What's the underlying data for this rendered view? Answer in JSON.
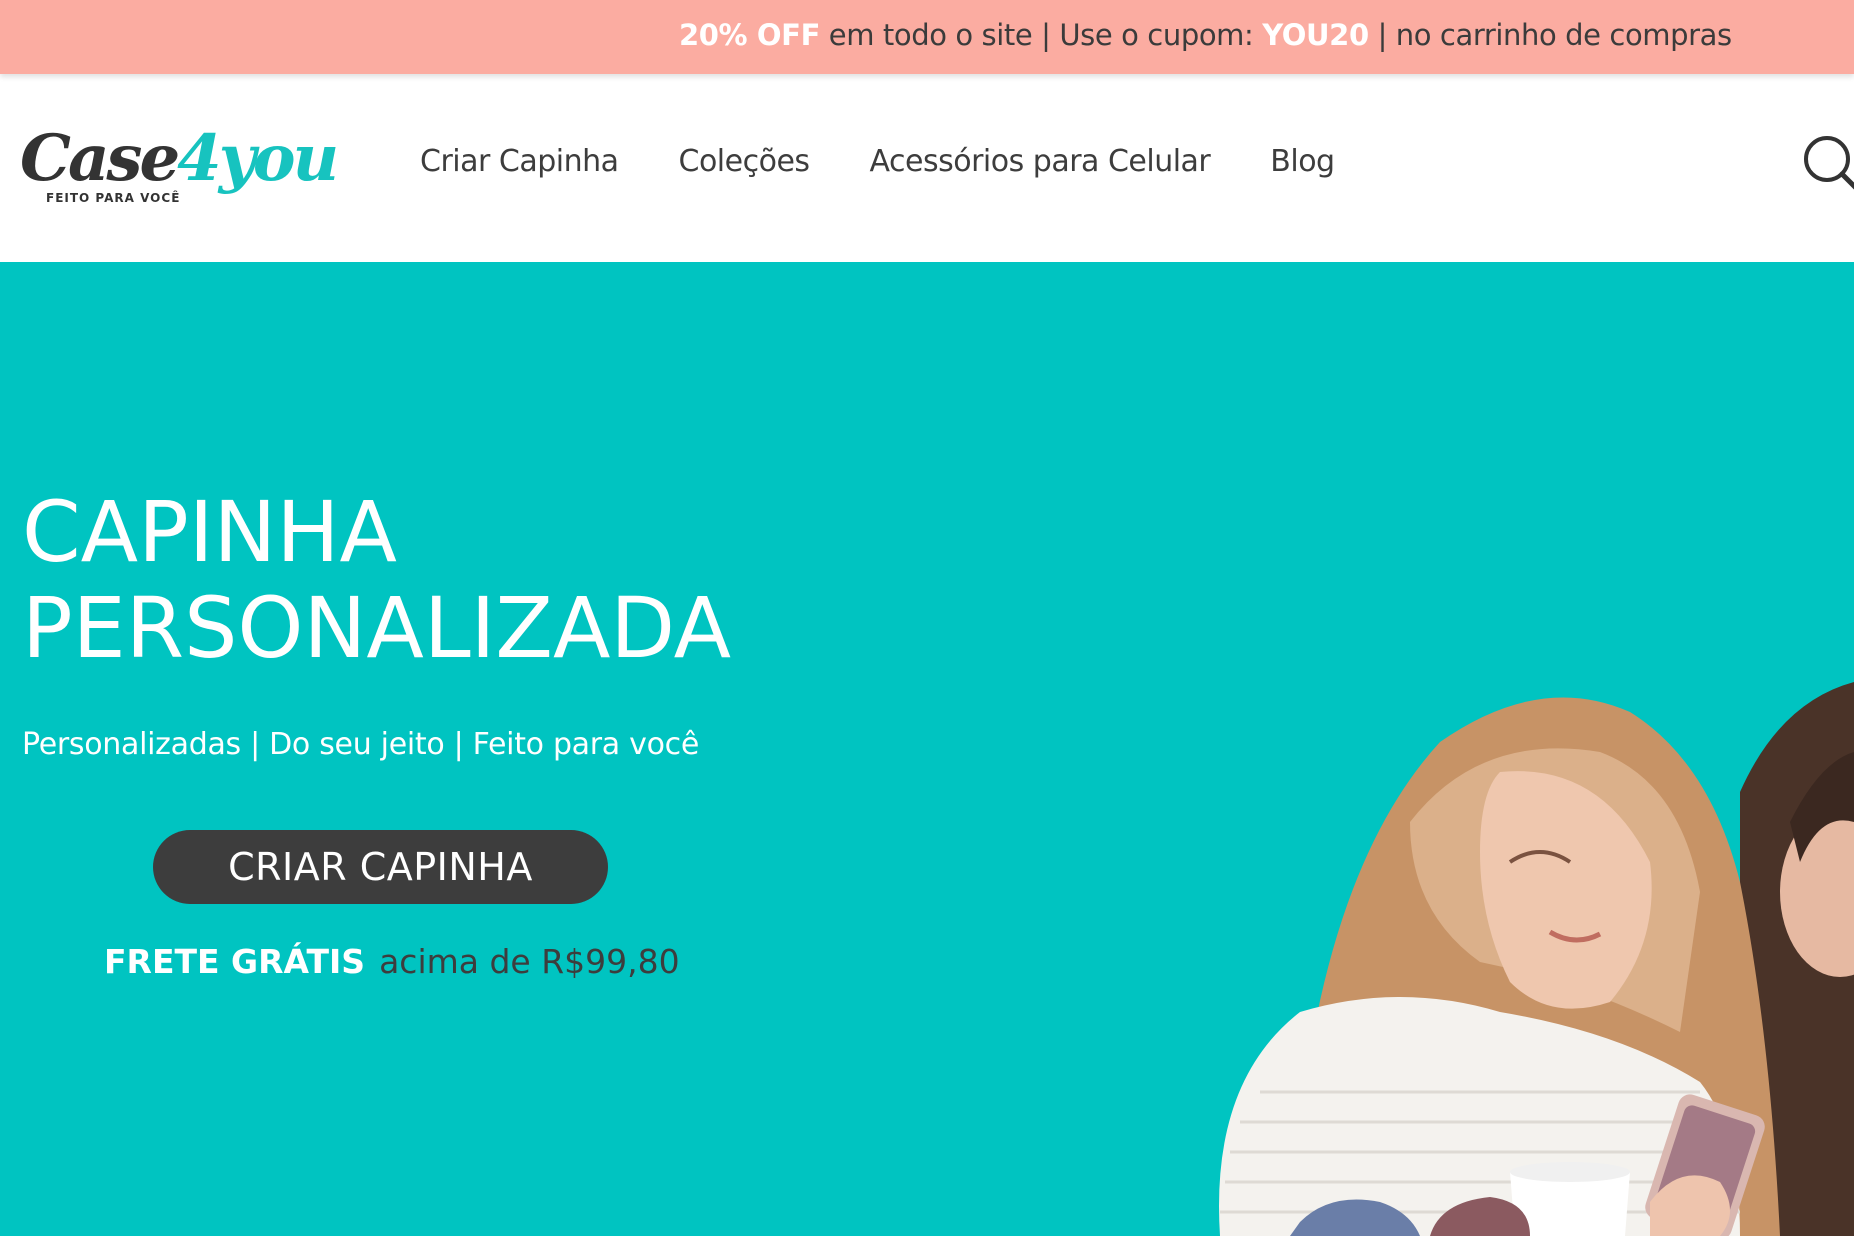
{
  "promo": {
    "highlight": "20% OFF",
    "text1": " em todo o site | Use o cupom: ",
    "coupon": "YOU20",
    "text2": " | no carrinho de compras"
  },
  "header": {
    "logo": {
      "main": "Case",
      "accent": "4you",
      "tagline": "FEITO PARA VOCÊ"
    },
    "nav": [
      {
        "label": "Criar Capinha"
      },
      {
        "label": "Coleções"
      },
      {
        "label": "Acessórios para Celular"
      },
      {
        "label": "Blog"
      }
    ],
    "search_icon": "search-icon"
  },
  "hero": {
    "title_line1": "CAPINHA",
    "title_line2": "PERSONALIZADA",
    "subtitle": "Personalizadas | Do seu jeito | Feito para você",
    "cta_label": "CRIAR CAPINHA",
    "shipping_bold": "FRETE GRÁTIS",
    "shipping_text": "acima de R$99,80"
  },
  "colors": {
    "promo_bg": "#fbaca1",
    "hero_bg": "#00c4c1",
    "accent": "#17c3bf",
    "dark": "#3d3d3d"
  }
}
